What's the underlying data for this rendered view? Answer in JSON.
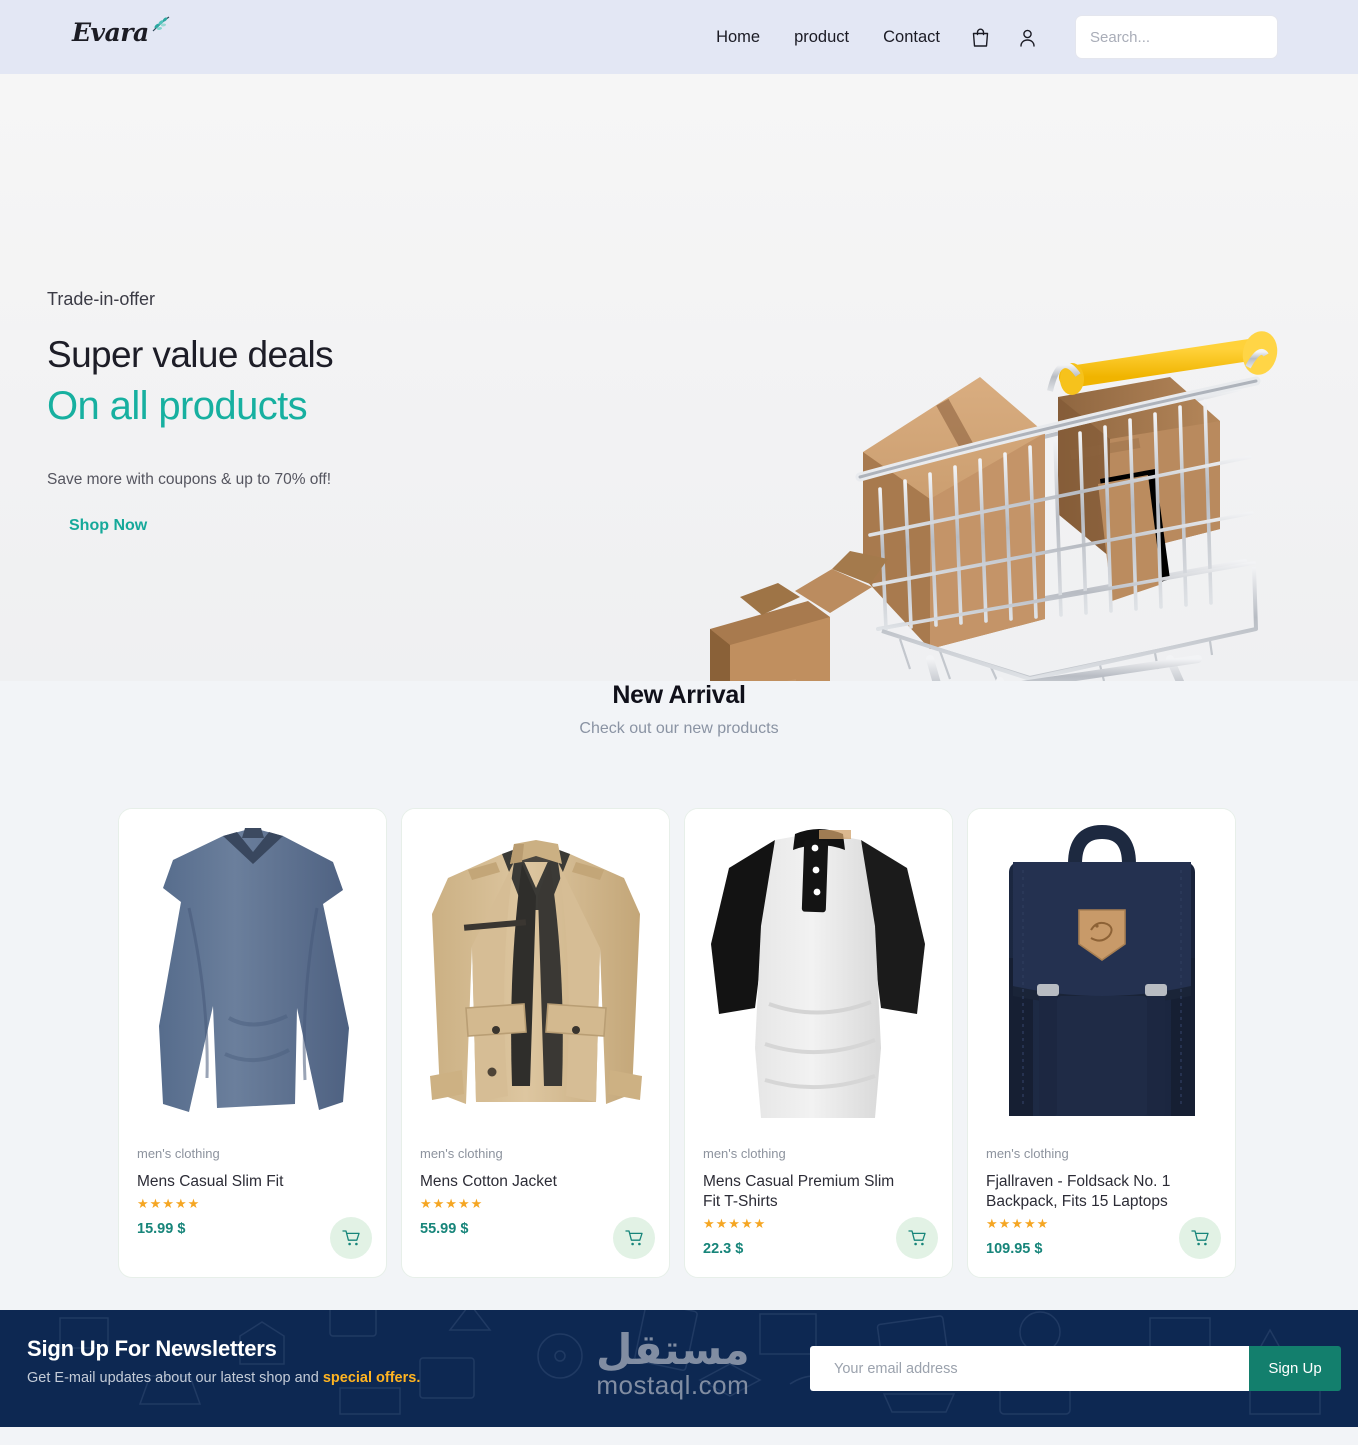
{
  "header": {
    "logo_text": "Evara",
    "logo_icon": "leaf-branch-icon",
    "nav": [
      {
        "label": "Home"
      },
      {
        "label": "product"
      },
      {
        "label": "Contact"
      }
    ],
    "bag_icon": "shopping-bag-icon",
    "account_icon": "user-account-icon",
    "search": {
      "placeholder": "Search...",
      "value": "",
      "icon": "search-icon"
    }
  },
  "hero": {
    "kicker": "Trade-in-offer",
    "heading": "Super value deals",
    "subheading": "On all products",
    "description": "Save more with coupons & up to 70% off!",
    "cta_label": "Shop Now",
    "image_alt": "shopping-cart-with-boxes",
    "accent_color": "#17b0a0",
    "cta_highlight_color": "#f2dfb7"
  },
  "arrival": {
    "title": "New Arrival",
    "subtitle": "Check out our new products"
  },
  "products": [
    {
      "category": "men's clothing",
      "name": "Mens Casual Slim Fit",
      "rating_stars": "★★★★★",
      "price": "15.99 $",
      "image": "blue-long-sleeve-shirt",
      "cart_icon": "cart-icon"
    },
    {
      "category": "men's clothing",
      "name": "Mens Cotton Jacket",
      "rating_stars": "★★★★★",
      "price": "55.99 $",
      "image": "khaki-cotton-jacket",
      "cart_icon": "cart-icon"
    },
    {
      "category": "men's clothing",
      "name": "Mens Casual Premium Slim Fit T-Shirts",
      "rating_stars": "★★★★★",
      "price": "22.3 $",
      "image": "grey-black-raglan-henley",
      "cart_icon": "cart-icon"
    },
    {
      "category": "men's clothing",
      "name": "Fjallraven - Foldsack No. 1 Backpack, Fits 15 Laptops",
      "rating_stars": "★★★★★",
      "price": "109.95 $",
      "image": "navy-foldsack-backpack",
      "cart_icon": "cart-icon"
    }
  ],
  "newsletter": {
    "title": "Sign Up For Newsletters",
    "subtitle_prefix": "Get E-mail updates about our latest shop and ",
    "subtitle_highlight": "special offers.",
    "email_placeholder": "Your email address",
    "email_value": "",
    "submit_label": "Sign Up",
    "background_color": "#0d2852",
    "button_color": "#137f6d",
    "highlight_color": "#ffb421"
  },
  "watermark": {
    "arabic": "مستقل",
    "latin": "mostaql.com"
  }
}
